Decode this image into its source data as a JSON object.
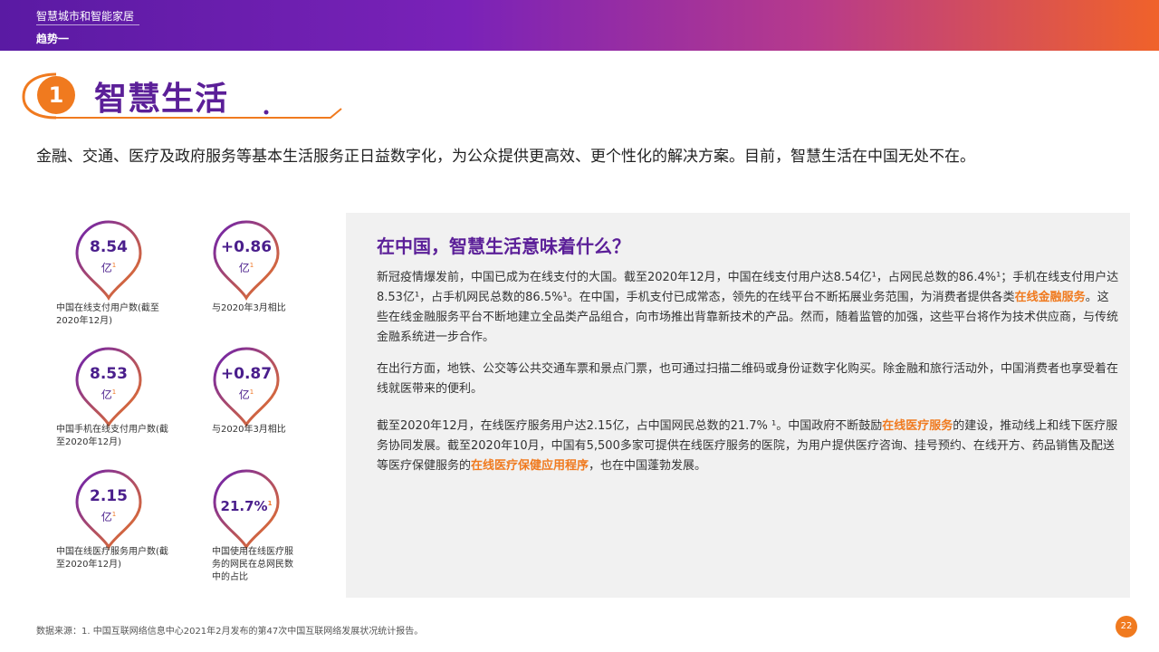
{
  "header": {
    "category": "智慧城市和智能家居",
    "trend": "趋势一"
  },
  "section": {
    "number": "1",
    "title": "智慧生活"
  },
  "intro": "金融、交通、医疗及政府服务等基本生活服务正日益数字化，为公众提供更高效、更个性化的解决方案。目前，智慧生活在中国无处不在。",
  "stats": [
    {
      "value": "8.54",
      "unit": "亿",
      "sup": "1",
      "label": "中国在线支付用户数(截至2020年12月)"
    },
    {
      "value": "+0.86",
      "unit": "亿",
      "sup": "1",
      "label": "与2020年3月相比"
    },
    {
      "value": "8.53",
      "unit": "亿",
      "sup": "1",
      "label": "中国手机在线支付用户数(截至2020年12月)"
    },
    {
      "value": "+0.87",
      "unit": "亿",
      "sup": "1",
      "label": "与2020年3月相比"
    },
    {
      "value": "2.15",
      "unit": "亿",
      "sup": "1",
      "label": "中国在线医疗服务用户数(截至2020年12月)"
    },
    {
      "value": "21.7%",
      "unit": "",
      "sup": "1",
      "label": "中国使用在线医疗服务的网民在总网民数中的占比"
    }
  ],
  "panel": {
    "heading": "在中国，智慧生活意味着什么？",
    "p1": {
      "a": "新冠疫情爆发前，中国已成为在线支付的大国。截至2020年12月，中国在线支付用户达8.54亿¹，占网民总数的86.4%¹；手机在线支付用户达8.53亿¹，占手机网民总数的86.5%¹。在中国，手机支付已成常态，领先的在线平台不断拓展业务范围，为消费者提供各类",
      "hl": "在线金融服务",
      "b": "。这些在线金融服务平台不断地建立全品类产品组合，向市场推出背靠新技术的产品。然而，随着监管的加强，这些平台将作为技术供应商，与传统金融系统进一步合作。"
    },
    "p2": "在出行方面，地铁、公交等公共交通车票和景点门票，也可通过扫描二维码或身份证数字化购买。除金融和旅行活动外，中国消费者也享受着在线就医带来的便利。",
    "p3": {
      "a": "截至2020年12月，在线医疗服务用户达2.15亿，占中国网民总数的21.7% ¹。中国政府不断鼓励",
      "hl1": "在线医疗服务",
      "b": "的建设，推动线上和线下医疗服务协同发展。截至2020年10月，中国有5,500多家可提供在线医疗服务的医院，为用户提供医疗咨询、挂号预约、在线开方、药品销售及配送等医疗保健服务的",
      "hl2": "在线医疗保健应用程序",
      "c": "，也在中国蓬勃发展。"
    }
  },
  "footnote": "数据来源：1. 中国互联网络信息中心2021年2月发布的第47次中国互联网络发展状况统计报告。",
  "page_number": "22",
  "colors": {
    "purple": "#5b1f98",
    "orange": "#f07a1f",
    "gradient_start": "#5a1aa3",
    "gradient_end": "#f0622a"
  }
}
